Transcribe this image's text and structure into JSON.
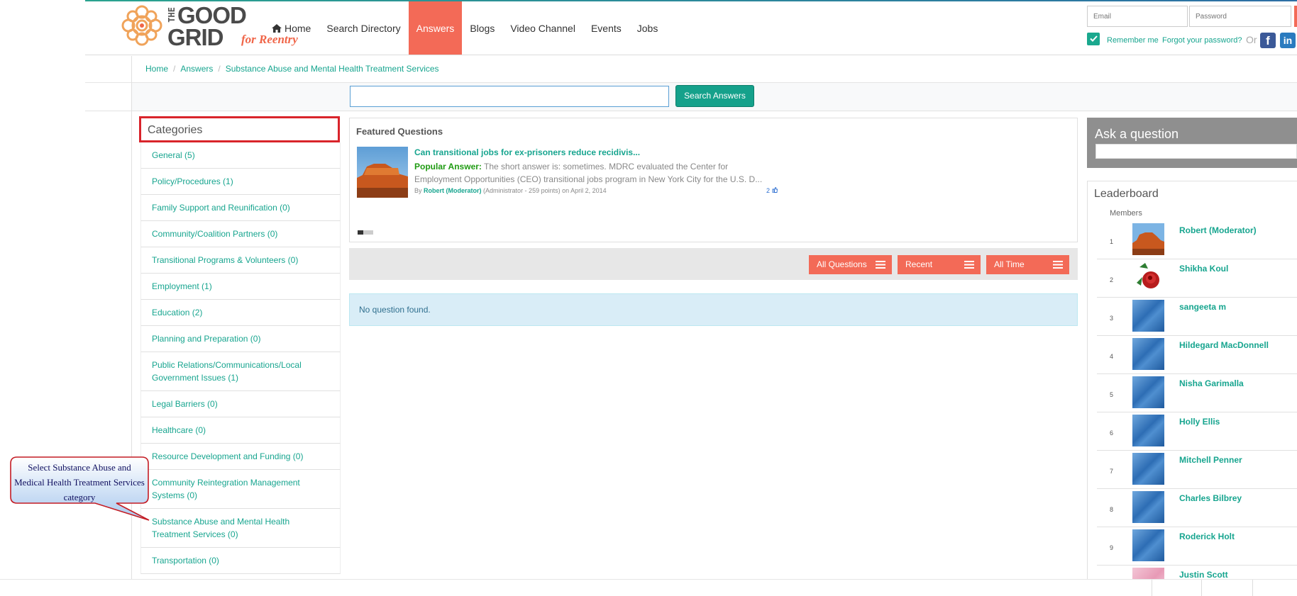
{
  "header": {
    "logo": {
      "the": "THE",
      "good": "GOOD",
      "grid": "GRID",
      "tag": "for Reentry"
    },
    "nav": [
      {
        "label": "Home",
        "icon": "home-icon"
      },
      {
        "label": "Search Directory"
      },
      {
        "label": "Answers",
        "active": true
      },
      {
        "label": "Blogs"
      },
      {
        "label": "Video Channel"
      },
      {
        "label": "Events"
      },
      {
        "label": "Jobs"
      }
    ],
    "login": {
      "email_placeholder": "Email",
      "password_placeholder": "Password",
      "remember_label": "Remember me",
      "forgot_label": "Forgot your password?",
      "or_label": "Or"
    }
  },
  "breadcrumb": {
    "items": [
      "Home",
      "Answers",
      "Substance Abuse and Mental Health Treatment Services"
    ]
  },
  "search": {
    "value": "",
    "button_label": "Search Answers"
  },
  "categories": {
    "title": "Categories",
    "items": [
      "General (5)",
      "Policy/Procedures (1)",
      "Family Support and Reunification (0)",
      "Community/Coalition Partners (0)",
      "Transitional Programs & Volunteers (0)",
      "Employment (1)",
      "Education (2)",
      "Planning and Preparation (0)",
      "Public Relations/Communications/Local Government Issues (1)",
      "Legal Barriers (0)",
      "Healthcare (0)",
      "Resource Development and Funding (0)",
      "Community Reintegration Management Systems (0)",
      "Substance Abuse and Mental Health Treatment Services (0)",
      "Transportation (0)"
    ]
  },
  "featured": {
    "title": "Featured Questions",
    "question": "Can transitional jobs for ex-prisoners reduce recidivis...",
    "popular_label": "Popular Answer:",
    "answer": "The short answer is: sometimes. MDRC evaluated the Center for Employment Opportunities (CEO) transitional jobs program in New York City for the U.S. D...",
    "by_label": "By",
    "author": "Robert (Moderator)",
    "author_meta": "(Administrator - 259 points)",
    "date": "on April 2, 2014",
    "likes": "2"
  },
  "filters": {
    "questions": "All Questions",
    "sort": "Recent",
    "period": "All Time"
  },
  "results": {
    "empty_message": "No question found."
  },
  "ask": {
    "title": "Ask a question"
  },
  "leaderboard": {
    "title": "Leaderboard",
    "subtitle": "Members",
    "members": [
      {
        "rank": "1",
        "name": "Robert (Moderator)",
        "avatar": "canyon"
      },
      {
        "rank": "2",
        "name": "Shikha Koul",
        "avatar": "rose"
      },
      {
        "rank": "3",
        "name": "sangeeta m",
        "avatar": "blue"
      },
      {
        "rank": "4",
        "name": "Hildegard MacDonnell",
        "avatar": "blue"
      },
      {
        "rank": "5",
        "name": "Nisha Garimalla",
        "avatar": "blue"
      },
      {
        "rank": "6",
        "name": "Holly Ellis",
        "avatar": "blue"
      },
      {
        "rank": "7",
        "name": "Mitchell Penner",
        "avatar": "blue"
      },
      {
        "rank": "8",
        "name": "Charles Bilbrey",
        "avatar": "blue"
      },
      {
        "rank": "9",
        "name": "Roderick Holt",
        "avatar": "blue"
      },
      {
        "rank": "",
        "name": "Justin Scott",
        "avatar": "pink"
      }
    ]
  },
  "callout": {
    "text": "Select Substance Abuse and Medical Health Treatment Services category"
  },
  "colors": {
    "accent": "#f36a57",
    "link": "#17a58f",
    "search_button": "#15a18b",
    "highlight_border": "#d9242b"
  }
}
